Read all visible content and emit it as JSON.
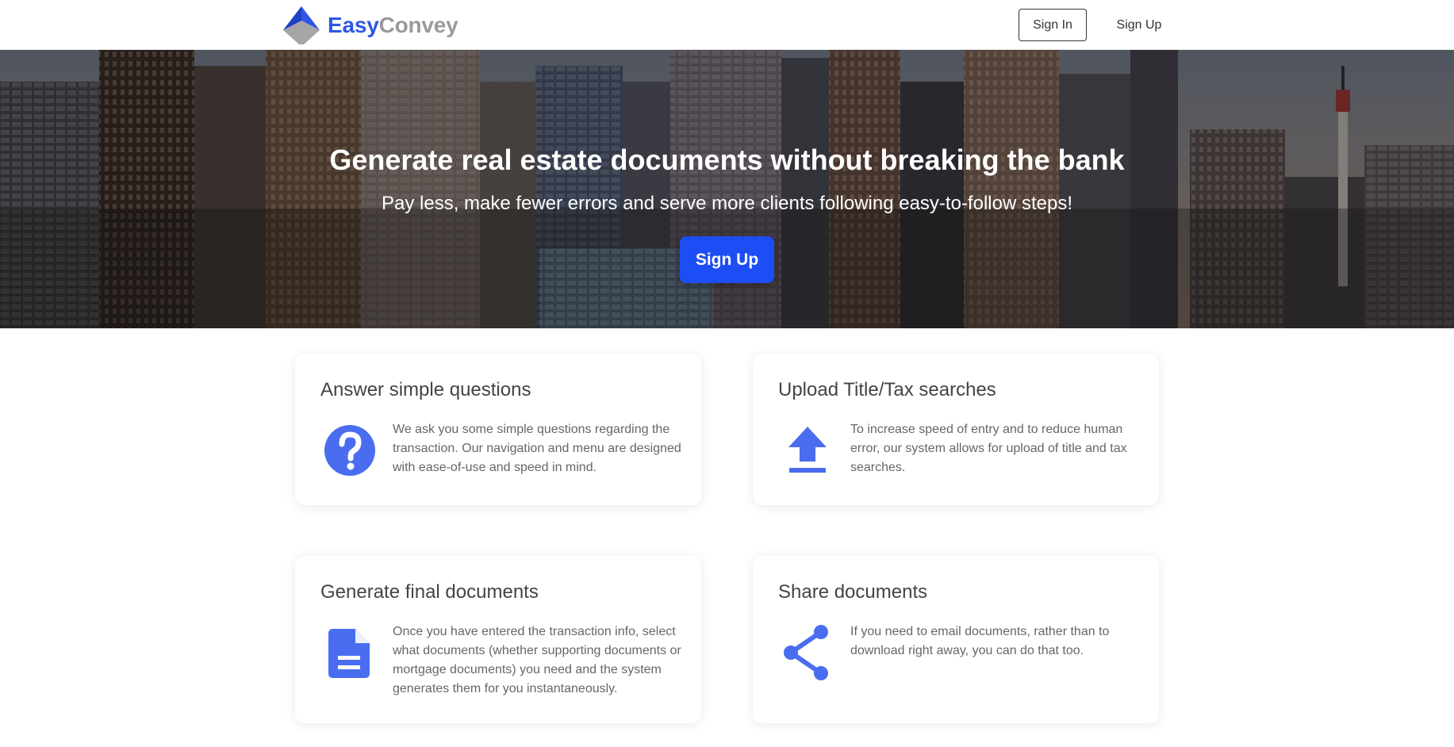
{
  "navbar": {
    "brand_part1": "Easy",
    "brand_part2": "Convey",
    "signin_label": "Sign In",
    "signup_label": "Sign Up"
  },
  "hero": {
    "title": "Generate real estate documents without breaking the bank",
    "subtitle": "Pay less, make fewer errors and serve more clients following easy-to-follow steps!",
    "cta_label": "Sign Up"
  },
  "features": [
    {
      "title": "Answer simple questions",
      "icon": "question-icon",
      "text": "We ask you some simple questions regarding the transaction. Our navigation and menu are designed with ease-of-use and speed in mind."
    },
    {
      "title": "Upload Title/Tax searches",
      "icon": "upload-icon",
      "text": "To increase speed of entry and to reduce human error, our system allows for upload of title and tax searches."
    },
    {
      "title": "Generate final documents",
      "icon": "document-icon",
      "text": "Once you have entered the transaction info, select what documents (whether supporting documents or mortgage documents) you need and the system generates them for you instantaneously."
    },
    {
      "title": "Share documents",
      "icon": "share-icon",
      "text": "If you need to email documents, rather than to download right away, you can do that too."
    }
  ],
  "colors": {
    "accent": "#1d4ef5",
    "icon": "#4a6df0",
    "brand_blue": "#2f56e6",
    "brand_gray": "#9a9a9a"
  }
}
